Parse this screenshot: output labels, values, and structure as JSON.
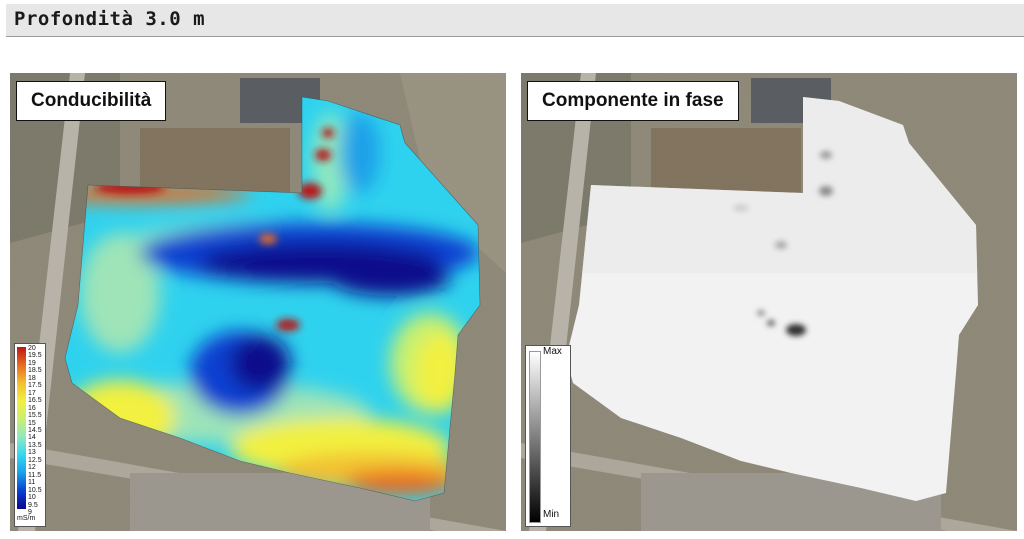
{
  "header": {
    "title": "Profondità 3.0 m"
  },
  "panels": [
    {
      "title": "Conducibilità"
    },
    {
      "title": "Componente in fase"
    }
  ],
  "conductivity_legend": {
    "labels": [
      "20",
      "19.5",
      "19",
      "18.5",
      "18",
      "17.5",
      "17",
      "16.5",
      "16",
      "15.5",
      "15",
      "14.5",
      "14",
      "13.5",
      "13",
      "12.5",
      "12",
      "11.5",
      "11",
      "10.5",
      "10",
      "9.5",
      "9"
    ],
    "unit": "mS/m",
    "colors": [
      "#08088c",
      "#0a3fd0",
      "#1aa0e8",
      "#33d8f0",
      "#8fe8c0",
      "#c8f070",
      "#f2f040",
      "#f2c030",
      "#e86a20",
      "#b81818"
    ]
  },
  "phase_legend": {
    "max_label": "Max",
    "min_label": "Min"
  },
  "colors": {
    "header_bg": "#e7e7e7",
    "aerial_base": "#8a8473"
  }
}
